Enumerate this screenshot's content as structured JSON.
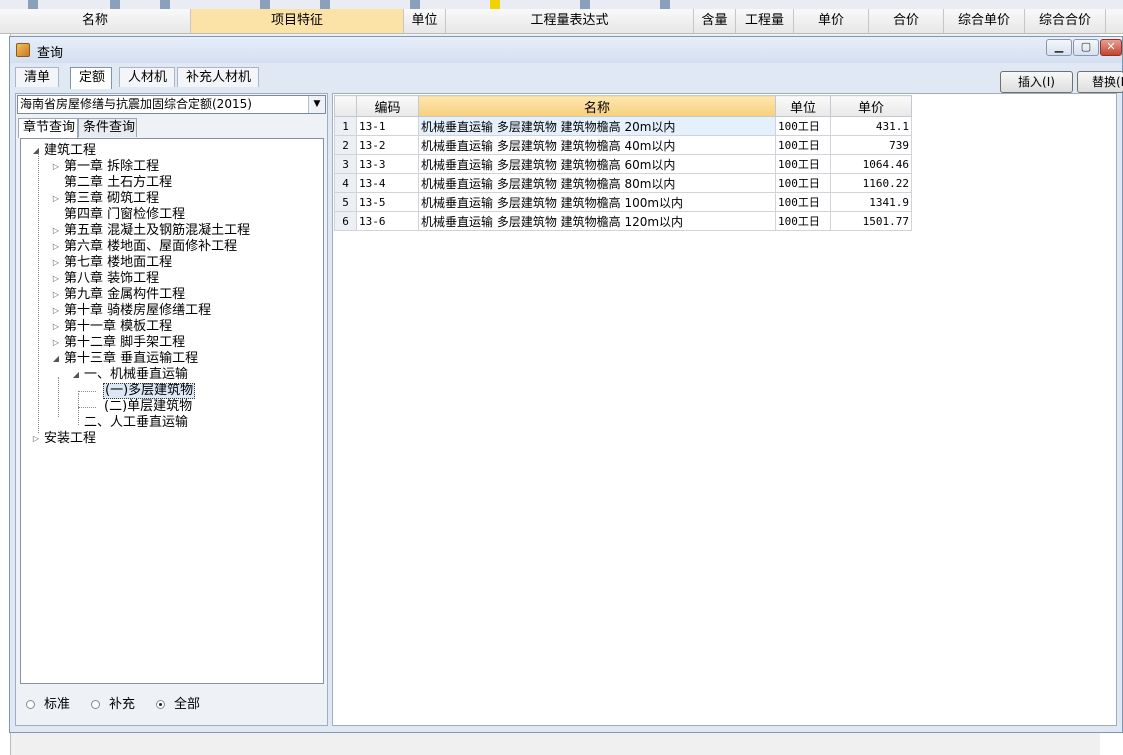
{
  "background_app": {
    "columns": [
      "名称",
      "项目特征",
      "单位",
      "工程量表达式",
      "含量",
      "工程量",
      "单价",
      "合价",
      "综合单价",
      "综合合价"
    ],
    "selected_column": "项目特征"
  },
  "dialog": {
    "title": "查询",
    "top_tabs": [
      {
        "label": "清单",
        "active": false
      },
      {
        "label": "定额",
        "active": true
      },
      {
        "label": "人材机",
        "active": false
      },
      {
        "label": "补充人材机",
        "active": false
      }
    ],
    "action_buttons": {
      "insert": "插入(I)",
      "replace": "替换(R)"
    }
  },
  "left": {
    "library_select": "海南省房屋修缮与抗震加固综合定额(2015)",
    "sub_tabs": [
      {
        "label": "章节查询",
        "active": true
      },
      {
        "label": "条件查询",
        "active": false
      }
    ],
    "tree": [
      {
        "label": "建筑工程",
        "level": 0,
        "expanded": true
      },
      {
        "label": "第一章 拆除工程",
        "level": 1,
        "expanded": false
      },
      {
        "label": "第二章 土石方工程",
        "level": 1,
        "expanded": null
      },
      {
        "label": "第三章 砌筑工程",
        "level": 1,
        "expanded": false
      },
      {
        "label": "第四章 门窗检修工程",
        "level": 1,
        "expanded": null
      },
      {
        "label": "第五章 混凝土及钢筋混凝土工程",
        "level": 1,
        "expanded": false
      },
      {
        "label": "第六章 楼地面、屋面修补工程",
        "level": 1,
        "expanded": false
      },
      {
        "label": "第七章 楼地面工程",
        "level": 1,
        "expanded": false
      },
      {
        "label": "第八章 装饰工程",
        "level": 1,
        "expanded": false
      },
      {
        "label": "第九章 金属构件工程",
        "level": 1,
        "expanded": false
      },
      {
        "label": "第十章 骑楼房屋修缮工程",
        "level": 1,
        "expanded": false
      },
      {
        "label": "第十一章 模板工程",
        "level": 1,
        "expanded": false
      },
      {
        "label": "第十二章 脚手架工程",
        "level": 1,
        "expanded": false
      },
      {
        "label": "第十三章 垂直运输工程",
        "level": 1,
        "expanded": true
      },
      {
        "label": "一、机械垂直运输",
        "level": 2,
        "expanded": true
      },
      {
        "label": "(一)多层建筑物",
        "level": 3,
        "expanded": null,
        "selected": true
      },
      {
        "label": "(二)单层建筑物",
        "level": 3,
        "expanded": null
      },
      {
        "label": "二、人工垂直运输",
        "level": 2,
        "expanded": null
      },
      {
        "label": "安装工程",
        "level": 0,
        "expanded": false
      }
    ],
    "radios": [
      {
        "label": "标准",
        "checked": false
      },
      {
        "label": "补充",
        "checked": false
      },
      {
        "label": "全部",
        "checked": true
      }
    ]
  },
  "grid": {
    "headers": {
      "code": "编码",
      "name": "名称",
      "unit": "单位",
      "price": "单价"
    },
    "rows": [
      {
        "n": "1",
        "code": "13-1",
        "name": "机械垂直运输 多层建筑物 建筑物檐高 20m以内",
        "unit": "100工日",
        "price": "431.1"
      },
      {
        "n": "2",
        "code": "13-2",
        "name": "机械垂直运输 多层建筑物 建筑物檐高 40m以内",
        "unit": "100工日",
        "price": "739"
      },
      {
        "n": "3",
        "code": "13-3",
        "name": "机械垂直运输 多层建筑物 建筑物檐高 60m以内",
        "unit": "100工日",
        "price": "1064.46"
      },
      {
        "n": "4",
        "code": "13-4",
        "name": "机械垂直运输 多层建筑物 建筑物檐高 80m以内",
        "unit": "100工日",
        "price": "1160.22"
      },
      {
        "n": "5",
        "code": "13-5",
        "name": "机械垂直运输 多层建筑物 建筑物檐高 100m以内",
        "unit": "100工日",
        "price": "1341.9"
      },
      {
        "n": "6",
        "code": "13-6",
        "name": "机械垂直运输 多层建筑物 建筑物檐高 120m以内",
        "unit": "100工日",
        "price": "1501.77"
      }
    ]
  },
  "colors": {
    "selected_header": "#f7cf7b",
    "dialog_bg": "#dfe8f3",
    "close_button": "#c4432e"
  }
}
